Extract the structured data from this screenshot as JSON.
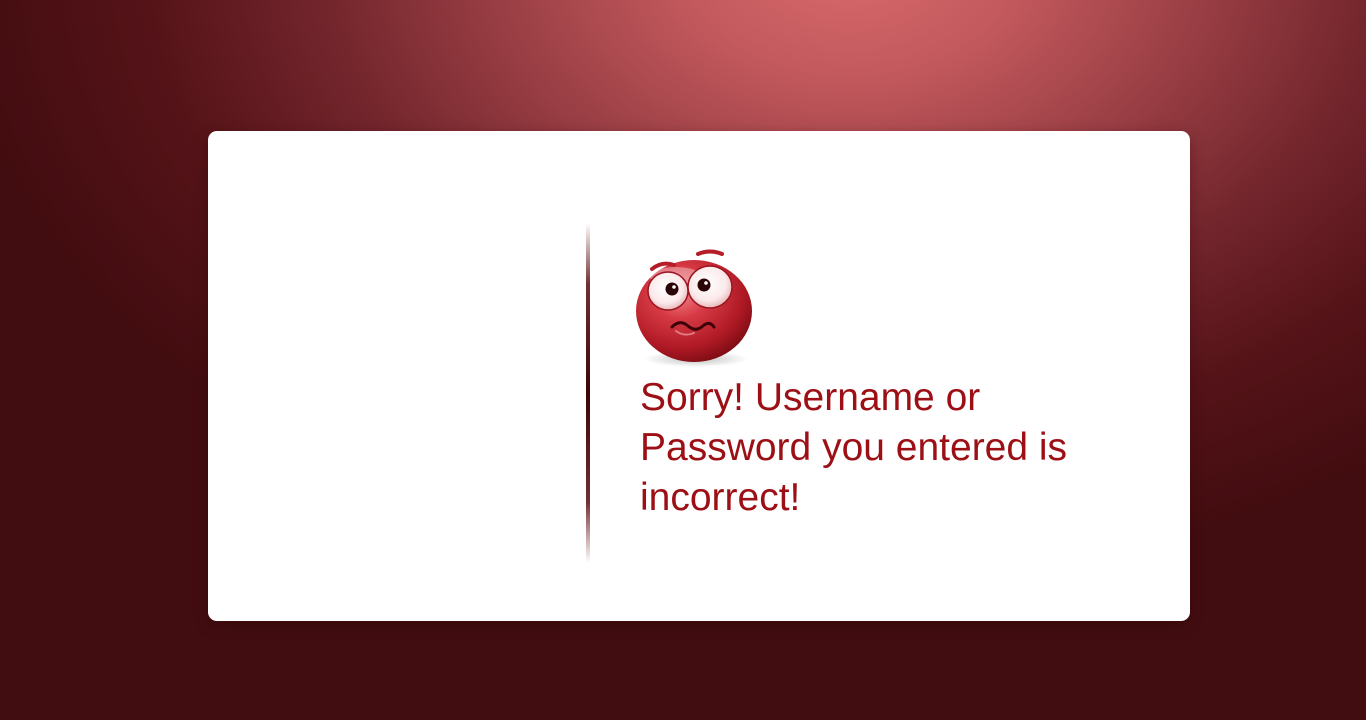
{
  "error_dialog": {
    "message": "Sorry! Username or Password you entered is incorrect!",
    "icon": "confused-emoticon-icon"
  },
  "colors": {
    "accent": "#9c0f15",
    "background_light": "#d86a6c",
    "background_dark": "#420d10",
    "card": "#ffffff"
  }
}
